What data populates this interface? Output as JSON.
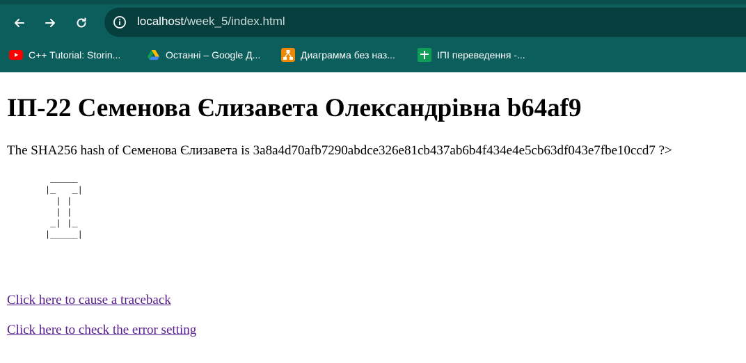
{
  "browser": {
    "url_host": "localhost",
    "url_path": "/week_5/index.html",
    "bookmarks": [
      {
        "label": "C++ Tutorial: Storin...",
        "icon": "youtube-icon"
      },
      {
        "label": "Останні – Google Д...",
        "icon": "google-drive-icon"
      },
      {
        "label": "Диаграмма без наз...",
        "icon": "drawio-icon"
      },
      {
        "label": "ІПІ переведення -...",
        "icon": "google-sheets-icon"
      }
    ]
  },
  "page": {
    "heading": "ІП-22 Семенова Єлизавета Олександрівна b64af9",
    "hash_text": "The SHA256 hash of Семенова Єлизавета is 3a8a4d70afb7290abdce326e81cb437ab6b4f434e4e5cb63df043e7fbe10ccd7 ?>",
    "ascii_art": "        _____\n       |_   _|\n         | |\n         | |\n        _| |_\n       |_____|",
    "link_traceback": "Click here to cause a traceback",
    "link_error_setting": "Click here to check the error setting"
  },
  "colors": {
    "chrome": "#0b5e5c",
    "omnibox": "#073f3f",
    "visited_link": "#551a8b"
  }
}
